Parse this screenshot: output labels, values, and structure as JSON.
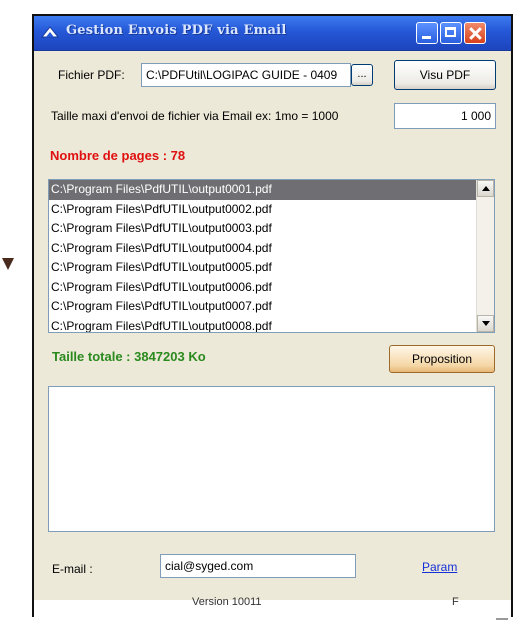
{
  "window": {
    "title": "Gestion Envois PDF via Email"
  },
  "fichier": {
    "label": "Fichier PDF:",
    "value": "C:\\PDFUtil\\LOGIPAC GUIDE - 0409",
    "browse_label": "...",
    "visu_label": "Visu PDF"
  },
  "taille_maxi": {
    "label": "Taille maxi d'envoi de fichier via Email ex: 1mo = 1000",
    "value": "1 000"
  },
  "pages": {
    "text": "Nombre de pages : 78"
  },
  "files": {
    "items": [
      "C:\\Program Files\\PdfUTIL\\output0001.pdf",
      "C:\\Program Files\\PdfUTIL\\output0002.pdf",
      "C:\\Program Files\\PdfUTIL\\output0003.pdf",
      "C:\\Program Files\\PdfUTIL\\output0004.pdf",
      "C:\\Program Files\\PdfUTIL\\output0005.pdf",
      "C:\\Program Files\\PdfUTIL\\output0006.pdf",
      "C:\\Program Files\\PdfUTIL\\output0007.pdf",
      "C:\\Program Files\\PdfUTIL\\output0008.pdf"
    ],
    "selected_index": 0
  },
  "totals": {
    "text": "Taille totale : 3847203 Ko",
    "proposition_label": "Proposition"
  },
  "email": {
    "label": "E-mail :",
    "value": "cial@syged.com",
    "param_label": "Param"
  },
  "footer": {
    "version_text": "Version 10011",
    "button_text": "F"
  },
  "icons": {
    "app": "app-logo-icon",
    "minimize": "minimize-icon",
    "maximize": "maximize-icon",
    "close": "close-icon",
    "scroll_up": "scroll-up-icon",
    "scroll_down": "scroll-down-icon"
  },
  "colors": {
    "title_bar": "#2557d6",
    "page_count": "#e01010",
    "total_size": "#2a8a1e",
    "link": "#1530d8",
    "selection": "#6f6f73"
  }
}
